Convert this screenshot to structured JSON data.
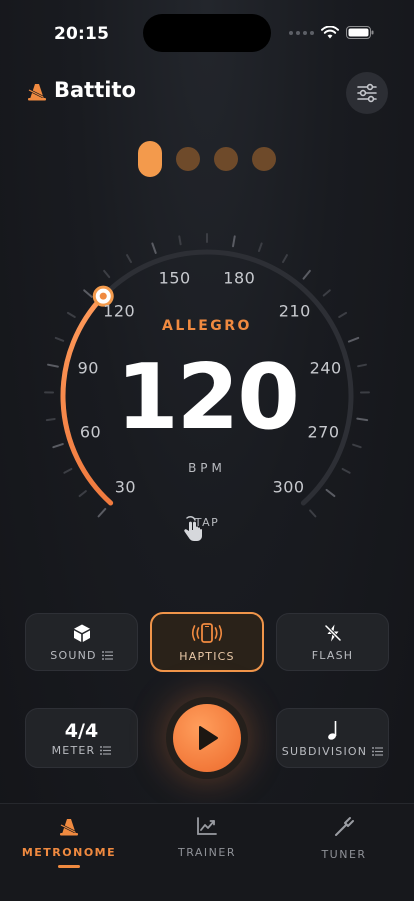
{
  "status": {
    "time": "20:15"
  },
  "app": {
    "name": "Battito"
  },
  "beats": {
    "count": 4,
    "active_index": 0
  },
  "dial": {
    "scale_labels": [
      "30",
      "60",
      "90",
      "120",
      "150",
      "180",
      "210",
      "240",
      "270",
      "300"
    ],
    "tempo_name": "ALLEGRO",
    "bpm": "120",
    "bpm_unit": "BPM",
    "progress": 0.333,
    "tap_label": "TAP"
  },
  "controls": {
    "sound": "SOUND",
    "haptics": "HAPTICS",
    "flash": "FLASH",
    "meter_value": "4/4",
    "meter_label": "METER",
    "subdivision_label": "SUBDIVISION"
  },
  "tabs": [
    {
      "label": "METRONOME",
      "icon": "metronome-icon",
      "active": true
    },
    {
      "label": "TRAINER",
      "icon": "chart-icon",
      "active": false
    },
    {
      "label": "TUNER",
      "icon": "tuning-fork-icon",
      "active": false
    }
  ],
  "colors": {
    "accent": "#f08a40",
    "beat_inactive": "#6e4a2a",
    "background": "#17181c"
  }
}
